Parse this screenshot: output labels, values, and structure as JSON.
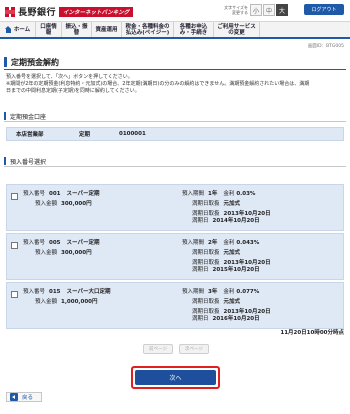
{
  "header": {
    "bank_name": "長野銀行",
    "service_badge": "インターネットバンキング",
    "display_size_label": "文字サイズを変更する",
    "size_small": "小",
    "size_medium": "中",
    "size_large": "大",
    "logout_label": "ログアウト"
  },
  "gnav": {
    "home": "ホーム",
    "items": [
      "口座情報",
      "振込・振替",
      "資産運用",
      "税金・各種料金の払込み(ペイジー)",
      "各種お申込み・手続き",
      "ご利用サービスの変更"
    ]
  },
  "screen_id": "画面ID：BTG005",
  "page_title": "定期預金解約",
  "instructions": {
    "line1": "預入番号を選択して、「次へ」ボタンを押してください。",
    "line2": "※期間が2年の定期預金(利息特約・元加式)の場合、2年定期(満期日)の分のみの解約はできません。満期預金解約されたい場合は、満期",
    "line3": "日までの中間利息定期(子定期)を同時に解約してください。"
  },
  "account_section": {
    "title": "定期預金口座",
    "branch": "本店営業部",
    "type": "定期",
    "number": "0100001"
  },
  "deposit_section": {
    "title": "預入番号選択",
    "labels": {
      "deposit_no": "預入番号",
      "deposit_amount": "預入金額",
      "term": "預入期間",
      "rate": "金利",
      "maturity_handling": "満期日取扱",
      "deposit_date": "満期日取扱",
      "maturity_date": "満期日"
    },
    "items": [
      {
        "no": "001",
        "product": "スーパー定期",
        "amount": "300,000円",
        "term": "1年",
        "rate": "0.03%",
        "handling": "元加式",
        "start": "2013年10月20日",
        "maturity": "2014年10月20日"
      },
      {
        "no": "005",
        "product": "スーパー定期",
        "amount": "300,000円",
        "term": "2年",
        "rate": "0.043%",
        "handling": "元加式",
        "start": "2013年10月20日",
        "maturity": "2015年10月20日"
      },
      {
        "no": "015",
        "product": "スーパー大口定期",
        "amount": "1,000,000円",
        "term": "3年",
        "rate": "0.077%",
        "handling": "元加式",
        "start": "2013年10月20日",
        "maturity": "2016年10月20日"
      }
    ]
  },
  "as_of": "11月20日10時00分時点",
  "pager": {
    "prev": "前ページ",
    "next": "次ページ"
  },
  "next_button": "次へ",
  "back_button": "戻る"
}
